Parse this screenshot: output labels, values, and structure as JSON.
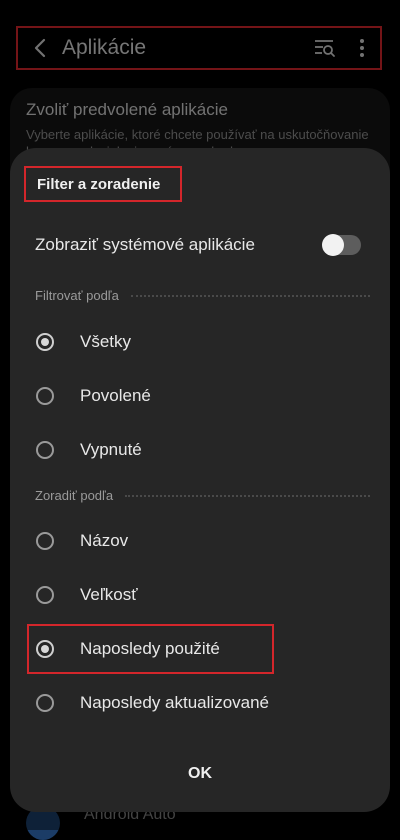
{
  "header": {
    "title": "Aplikácie",
    "back_icon": "chevron-left-icon",
    "filter_icon": "filter-search-icon",
    "more_icon": "more-vertical-icon"
  },
  "background": {
    "card_title": "Zvoliť predvolené aplikácie",
    "card_subtitle": "Vyberte aplikácie, ktoré chcete používať na uskutočňovanie hovorov, odosielanie správ, prechod na",
    "bottom_item": "Android Auto"
  },
  "dialog": {
    "title": "Filter a zoradenie",
    "toggle_label": "Zobraziť systémové aplikácie",
    "toggle_on": false,
    "filter_section": "Filtrovať podľa",
    "filter_options": [
      "Všetky",
      "Povolené",
      "Vypnuté"
    ],
    "filter_selected": "Všetky",
    "sort_section": "Zoradiť podľa",
    "sort_options": [
      "Názov",
      "Veľkosť",
      "Naposledy použité",
      "Naposledy aktualizované"
    ],
    "sort_selected": "Naposledy použité",
    "ok_label": "OK"
  },
  "colors": {
    "highlight": "#d3262b",
    "dialog_bg": "#262626"
  }
}
